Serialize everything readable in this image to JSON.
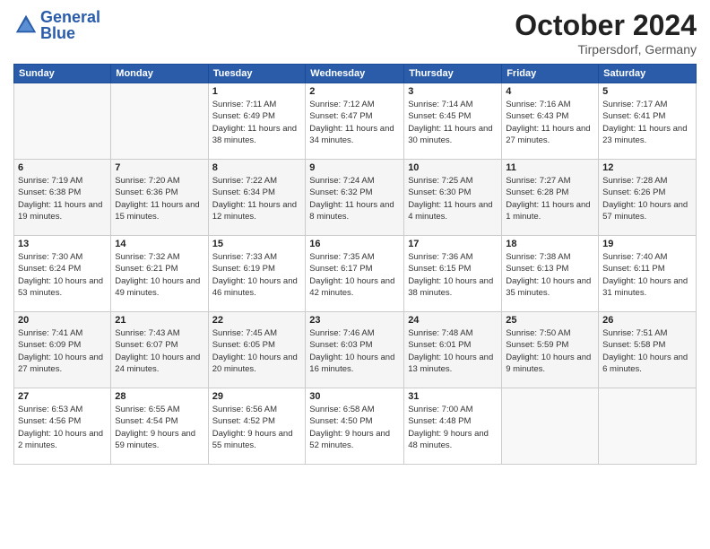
{
  "header": {
    "logo_line1": "General",
    "logo_line2": "Blue",
    "month_title": "October 2024",
    "location": "Tirpersdorf, Germany"
  },
  "weekdays": [
    "Sunday",
    "Monday",
    "Tuesday",
    "Wednesday",
    "Thursday",
    "Friday",
    "Saturday"
  ],
  "weeks": [
    [
      {
        "day": "",
        "info": ""
      },
      {
        "day": "",
        "info": ""
      },
      {
        "day": "1",
        "info": "Sunrise: 7:11 AM\nSunset: 6:49 PM\nDaylight: 11 hours and 38 minutes."
      },
      {
        "day": "2",
        "info": "Sunrise: 7:12 AM\nSunset: 6:47 PM\nDaylight: 11 hours and 34 minutes."
      },
      {
        "day": "3",
        "info": "Sunrise: 7:14 AM\nSunset: 6:45 PM\nDaylight: 11 hours and 30 minutes."
      },
      {
        "day": "4",
        "info": "Sunrise: 7:16 AM\nSunset: 6:43 PM\nDaylight: 11 hours and 27 minutes."
      },
      {
        "day": "5",
        "info": "Sunrise: 7:17 AM\nSunset: 6:41 PM\nDaylight: 11 hours and 23 minutes."
      }
    ],
    [
      {
        "day": "6",
        "info": "Sunrise: 7:19 AM\nSunset: 6:38 PM\nDaylight: 11 hours and 19 minutes."
      },
      {
        "day": "7",
        "info": "Sunrise: 7:20 AM\nSunset: 6:36 PM\nDaylight: 11 hours and 15 minutes."
      },
      {
        "day": "8",
        "info": "Sunrise: 7:22 AM\nSunset: 6:34 PM\nDaylight: 11 hours and 12 minutes."
      },
      {
        "day": "9",
        "info": "Sunrise: 7:24 AM\nSunset: 6:32 PM\nDaylight: 11 hours and 8 minutes."
      },
      {
        "day": "10",
        "info": "Sunrise: 7:25 AM\nSunset: 6:30 PM\nDaylight: 11 hours and 4 minutes."
      },
      {
        "day": "11",
        "info": "Sunrise: 7:27 AM\nSunset: 6:28 PM\nDaylight: 11 hours and 1 minute."
      },
      {
        "day": "12",
        "info": "Sunrise: 7:28 AM\nSunset: 6:26 PM\nDaylight: 10 hours and 57 minutes."
      }
    ],
    [
      {
        "day": "13",
        "info": "Sunrise: 7:30 AM\nSunset: 6:24 PM\nDaylight: 10 hours and 53 minutes."
      },
      {
        "day": "14",
        "info": "Sunrise: 7:32 AM\nSunset: 6:21 PM\nDaylight: 10 hours and 49 minutes."
      },
      {
        "day": "15",
        "info": "Sunrise: 7:33 AM\nSunset: 6:19 PM\nDaylight: 10 hours and 46 minutes."
      },
      {
        "day": "16",
        "info": "Sunrise: 7:35 AM\nSunset: 6:17 PM\nDaylight: 10 hours and 42 minutes."
      },
      {
        "day": "17",
        "info": "Sunrise: 7:36 AM\nSunset: 6:15 PM\nDaylight: 10 hours and 38 minutes."
      },
      {
        "day": "18",
        "info": "Sunrise: 7:38 AM\nSunset: 6:13 PM\nDaylight: 10 hours and 35 minutes."
      },
      {
        "day": "19",
        "info": "Sunrise: 7:40 AM\nSunset: 6:11 PM\nDaylight: 10 hours and 31 minutes."
      }
    ],
    [
      {
        "day": "20",
        "info": "Sunrise: 7:41 AM\nSunset: 6:09 PM\nDaylight: 10 hours and 27 minutes."
      },
      {
        "day": "21",
        "info": "Sunrise: 7:43 AM\nSunset: 6:07 PM\nDaylight: 10 hours and 24 minutes."
      },
      {
        "day": "22",
        "info": "Sunrise: 7:45 AM\nSunset: 6:05 PM\nDaylight: 10 hours and 20 minutes."
      },
      {
        "day": "23",
        "info": "Sunrise: 7:46 AM\nSunset: 6:03 PM\nDaylight: 10 hours and 16 minutes."
      },
      {
        "day": "24",
        "info": "Sunrise: 7:48 AM\nSunset: 6:01 PM\nDaylight: 10 hours and 13 minutes."
      },
      {
        "day": "25",
        "info": "Sunrise: 7:50 AM\nSunset: 5:59 PM\nDaylight: 10 hours and 9 minutes."
      },
      {
        "day": "26",
        "info": "Sunrise: 7:51 AM\nSunset: 5:58 PM\nDaylight: 10 hours and 6 minutes."
      }
    ],
    [
      {
        "day": "27",
        "info": "Sunrise: 6:53 AM\nSunset: 4:56 PM\nDaylight: 10 hours and 2 minutes."
      },
      {
        "day": "28",
        "info": "Sunrise: 6:55 AM\nSunset: 4:54 PM\nDaylight: 9 hours and 59 minutes."
      },
      {
        "day": "29",
        "info": "Sunrise: 6:56 AM\nSunset: 4:52 PM\nDaylight: 9 hours and 55 minutes."
      },
      {
        "day": "30",
        "info": "Sunrise: 6:58 AM\nSunset: 4:50 PM\nDaylight: 9 hours and 52 minutes."
      },
      {
        "day": "31",
        "info": "Sunrise: 7:00 AM\nSunset: 4:48 PM\nDaylight: 9 hours and 48 minutes."
      },
      {
        "day": "",
        "info": ""
      },
      {
        "day": "",
        "info": ""
      }
    ]
  ]
}
